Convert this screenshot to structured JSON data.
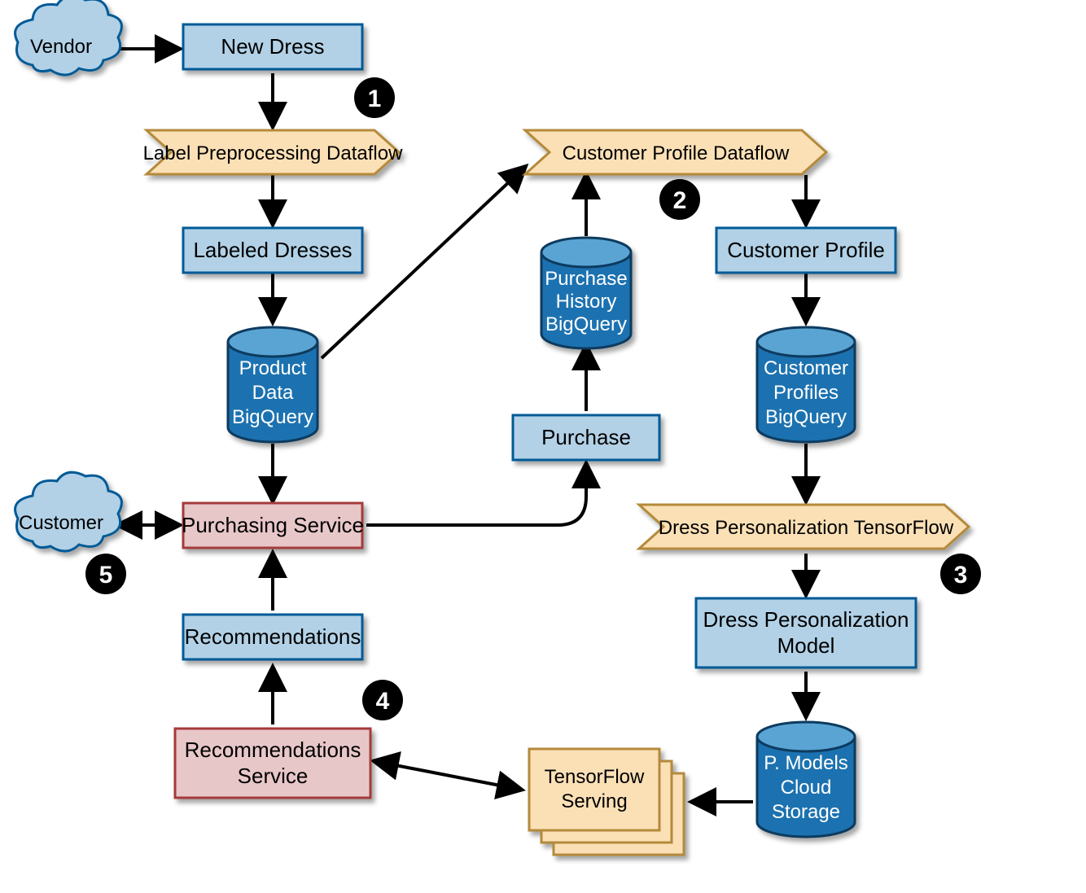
{
  "clouds": {
    "vendor": "Vendor",
    "customer": "Customer"
  },
  "steps": {
    "s1": "1",
    "s2": "2",
    "s3": "3",
    "s4": "4",
    "s5": "5"
  },
  "boxes": {
    "newDress": "New Dress",
    "labeledDresses": "Labeled Dresses",
    "customerProfile": "Customer Profile",
    "purchase": "Purchase",
    "purchasingService": "Purchasing Service",
    "recommendations": "Recommendations",
    "recommendationsServiceL1": "Recommendations",
    "recommendationsServiceL2": "Service",
    "dressPersModelL1": "Dress Personalization",
    "dressPersModelL2": "Model",
    "tfServingL1": "TensorFlow",
    "tfServingL2": "Serving"
  },
  "pipes": {
    "labelPre": "Label Preprocessing Dataflow",
    "custProfile": "Customer Profile Dataflow",
    "dressPers": "Dress Personalization TensorFlow"
  },
  "cylinders": {
    "productDataL1": "Product",
    "productDataL2": "Data",
    "productDataL3": "BigQuery",
    "purchHistL1": "Purchase",
    "purchHistL2": "History",
    "purchHistL3": "BigQuery",
    "custProfL1": "Customer",
    "custProfL2": "Profiles",
    "custProfL3": "BigQuery",
    "pmodelsL1": "P. Models",
    "pmodelsL2": "Cloud",
    "pmodelsL3": "Storage"
  },
  "colors": {
    "blueFill": "#b2d1e6",
    "blueStroke": "#005a97",
    "pinkFill": "#e8c7c9",
    "pinkStroke": "#a53a3a",
    "tanFill": "#fbe0b6",
    "tanStroke": "#b48a3a",
    "dbTop": "#5aa4d4",
    "dbSide": "#1f72b0",
    "badge": "#000000",
    "badgeText": "#ffffff",
    "arrow": "#000000"
  }
}
